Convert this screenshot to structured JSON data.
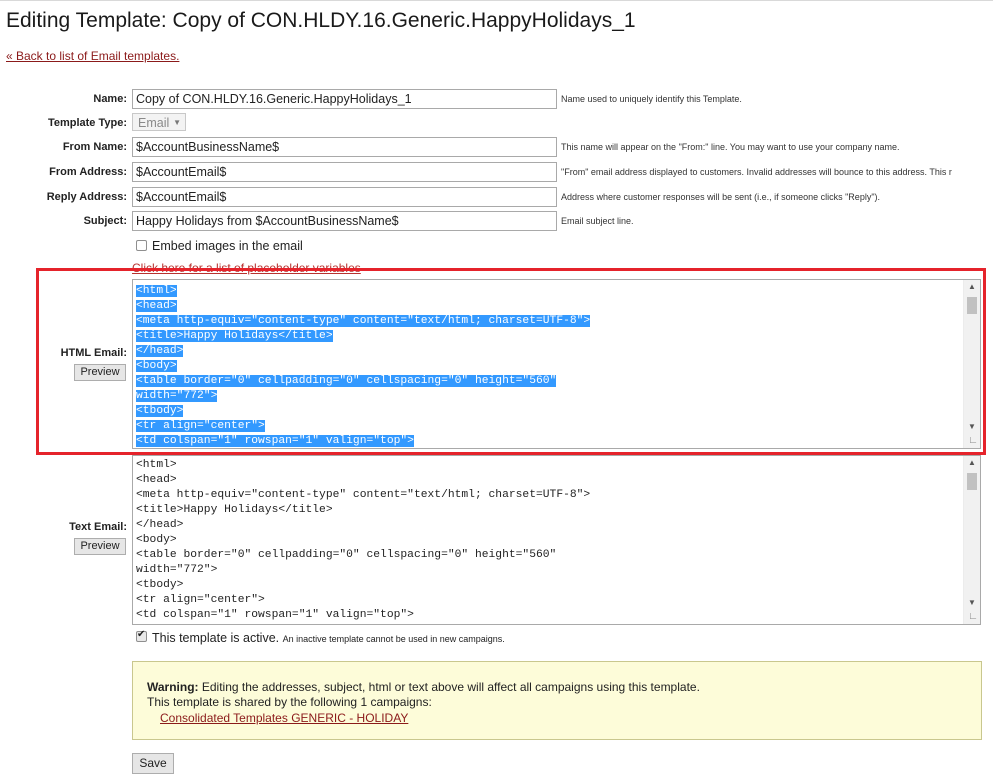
{
  "page": {
    "title": "Editing Template: Copy of CON.HLDY.16.Generic.HappyHolidays_1",
    "back_link": "« Back to list of Email templates."
  },
  "form": {
    "name": {
      "label": "Name:",
      "value": "Copy of CON.HLDY.16.Generic.HappyHolidays_1",
      "hint": "Name used to uniquely identify this Template."
    },
    "template_type": {
      "label": "Template Type:",
      "value": "Email"
    },
    "from_name": {
      "label": "From Name:",
      "value": "$AccountBusinessName$",
      "hint": "This name will appear on the \"From:\" line. You may want to use your company name."
    },
    "from_address": {
      "label": "From Address:",
      "value": "$AccountEmail$",
      "hint": "\"From\" email address displayed to customers. Invalid addresses will bounce to this address. This r"
    },
    "reply_address": {
      "label": "Reply Address:",
      "value": "$AccountEmail$",
      "hint": "Address where customer responses will be sent (i.e., if someone clicks \"Reply\")."
    },
    "subject": {
      "label": "Subject:",
      "value": "Happy Holidays from $AccountBusinessName$",
      "hint": "Email subject line."
    },
    "embed_images": {
      "label": "Embed images in the email",
      "checked": false
    },
    "placeholder_link": "Click here for a list of placeholder variables",
    "html_email": {
      "label": "HTML Email:",
      "preview_label": "Preview",
      "lines": [
        "<html>",
        "<head>",
        "<meta http-equiv=\"content-type\" content=\"text/html; charset=UTF-8\">",
        "<title>Happy Holidays</title>",
        "</head>",
        "<body>",
        "<table border=\"0\" cellpadding=\"0\" cellspacing=\"0\" height=\"560\"",
        "width=\"772\">",
        "<tbody>",
        "<tr align=\"center\">",
        "<td colspan=\"1\" rowspan=\"1\" valign=\"top\">"
      ]
    },
    "text_email": {
      "label": "Text Email:",
      "preview_label": "Preview",
      "lines": [
        "<html>",
        "<head>",
        "<meta http-equiv=\"content-type\" content=\"text/html; charset=UTF-8\">",
        "<title>Happy Holidays</title>",
        "</head>",
        "<body>",
        "<table border=\"0\" cellpadding=\"0\" cellspacing=\"0\" height=\"560\"",
        "width=\"772\">",
        "<tbody>",
        "<tr align=\"center\">",
        "<td colspan=\"1\" rowspan=\"1\" valign=\"top\">"
      ]
    },
    "active": {
      "label": "This template is active.",
      "note": "An inactive template cannot be used in new campaigns.",
      "checked": true
    }
  },
  "warning": {
    "bold": "Warning:",
    "message": " Editing the addresses, subject, html or text above will affect all campaigns using this template.",
    "shared": "This template is shared by the following 1 campaigns:",
    "campaign": "Consolidated Templates GENERIC - HOLIDAY"
  },
  "save_label": "Save",
  "colors": {
    "highlight": "#3399ff",
    "annotation_box": "#e5232b",
    "warning_bg": "#fdfcd9",
    "link": "#8b1a1a"
  }
}
